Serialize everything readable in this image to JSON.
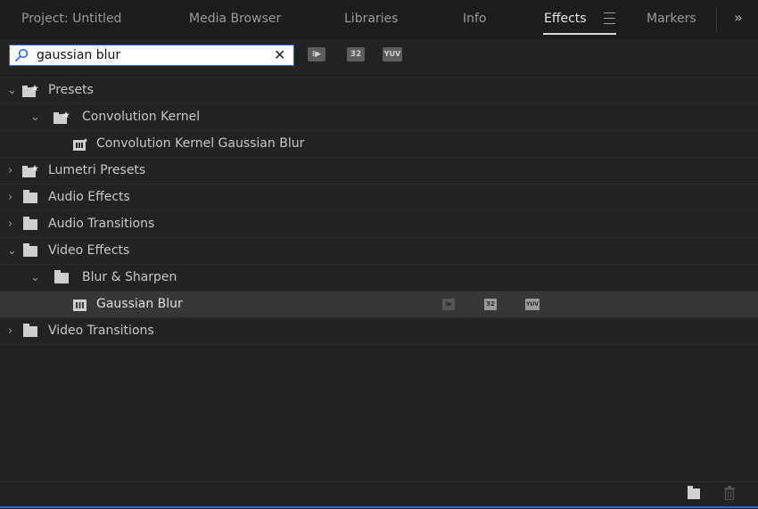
{
  "tabs": [
    {
      "label": "Project: Untitled",
      "active": false
    },
    {
      "label": "Media Browser",
      "active": false
    },
    {
      "label": "Libraries",
      "active": false
    },
    {
      "label": "Info",
      "active": false
    },
    {
      "label": "Effects",
      "active": true
    },
    {
      "label": "Markers",
      "active": false
    }
  ],
  "overflow_label": "»",
  "search": {
    "value": "gaussian blur",
    "icon": "search-icon",
    "clear_icon": "close-icon"
  },
  "filters": [
    {
      "label": "⁝▶",
      "name": "accelerated-effects-filter"
    },
    {
      "label": "32",
      "name": "32-bit-color-filter"
    },
    {
      "label": "YUV",
      "name": "yuv-effects-filter"
    }
  ],
  "tree": [
    {
      "label": "Presets",
      "expanded": true,
      "icon": "preset-folder-icon"
    },
    {
      "label": "Convolution Kernel",
      "expanded": true,
      "icon": "preset-folder-icon"
    },
    {
      "label": "Convolution Kernel Gaussian Blur",
      "icon": "preset-effect-icon"
    },
    {
      "label": "Lumetri Presets",
      "expanded": false,
      "icon": "preset-folder-icon"
    },
    {
      "label": "Audio Effects",
      "expanded": false,
      "icon": "folder-icon"
    },
    {
      "label": "Audio Transitions",
      "expanded": false,
      "icon": "folder-icon"
    },
    {
      "label": "Video Effects",
      "expanded": true,
      "icon": "folder-icon"
    },
    {
      "label": "Blur & Sharpen",
      "expanded": true,
      "icon": "folder-icon"
    },
    {
      "label": "Gaussian Blur",
      "icon": "effect-icon",
      "selected": true,
      "badges": [
        "⁝▶",
        "32",
        "YUV"
      ]
    },
    {
      "label": "Video Transitions",
      "expanded": false,
      "icon": "folder-icon"
    }
  ],
  "chevrons": {
    "expanded": "⌄",
    "collapsed": "›"
  },
  "colors": {
    "panel_bg": "#232323",
    "tab_bg": "#1d1d1d",
    "selected_row": "#373737",
    "accent_blue": "#2f6bd3"
  },
  "bottom_icons": [
    "new-bin-icon",
    "trash-icon"
  ]
}
